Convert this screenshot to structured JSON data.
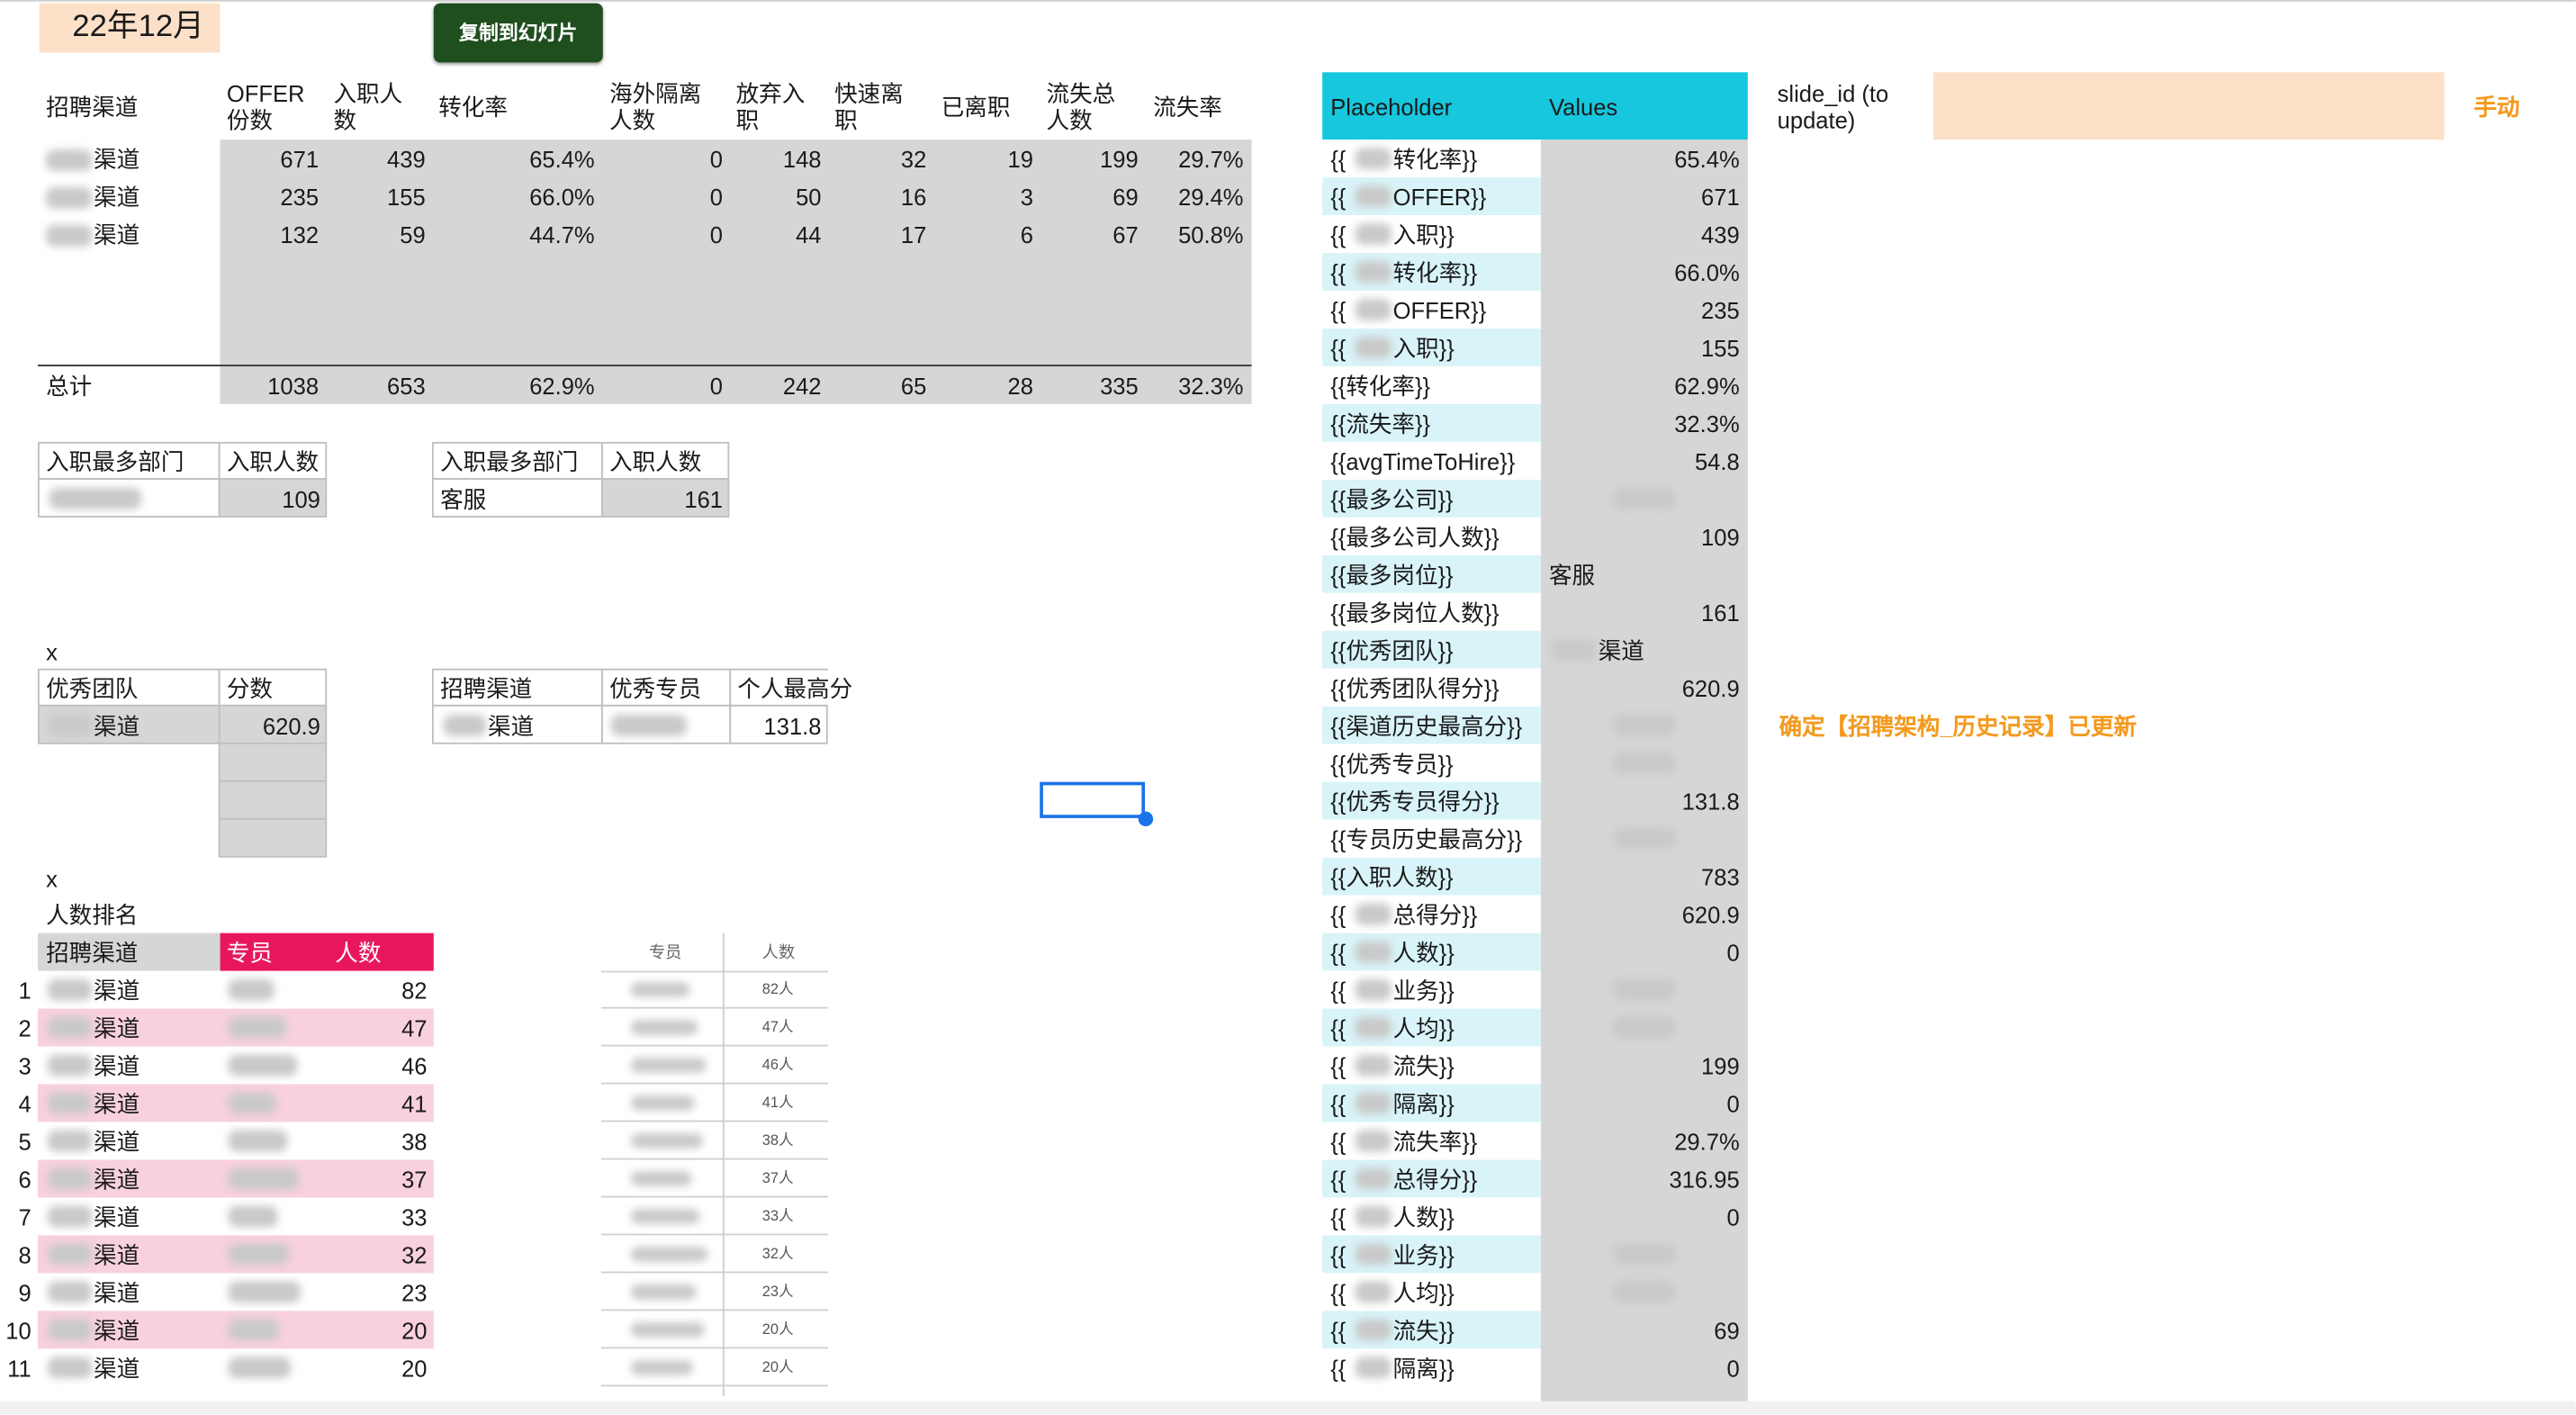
{
  "month_label": "22年12月",
  "copy_button": "复制到幻灯片",
  "channel_table": {
    "headers": [
      "招聘渠道",
      "OFFER\n份数",
      "入职人\n数",
      "转化率",
      "海外隔离\n人数",
      "放弃入\n职",
      "快速离\n职",
      "已离职",
      "流失总\n人数",
      "流失率"
    ],
    "rows": [
      {
        "channel_suffix": "渠道",
        "cells": [
          "671",
          "439",
          "65.4%",
          "0",
          "148",
          "32",
          "19",
          "199",
          "29.7%"
        ]
      },
      {
        "channel_suffix": "渠道",
        "cells": [
          "235",
          "155",
          "66.0%",
          "0",
          "50",
          "16",
          "3",
          "69",
          "29.4%"
        ]
      },
      {
        "channel_suffix": "渠道",
        "cells": [
          "132",
          "59",
          "44.7%",
          "0",
          "44",
          "17",
          "6",
          "67",
          "50.8%"
        ]
      }
    ],
    "total": {
      "label": "总计",
      "cells": [
        "1038",
        "653",
        "62.9%",
        "0",
        "242",
        "65",
        "28",
        "335",
        "32.3%"
      ]
    }
  },
  "dept_table_left": {
    "headers": [
      "入职最多部门",
      "入职人数"
    ],
    "value": "109"
  },
  "dept_table_right": {
    "headers": [
      "入职最多部门",
      "入职人数"
    ],
    "dept": "客服",
    "value": "161"
  },
  "x_marker": "x",
  "team_table": {
    "headers": [
      "优秀团队",
      "分数"
    ],
    "team_suffix": "渠道",
    "score": "620.9"
  },
  "specialist_table": {
    "headers": [
      "招聘渠道",
      "优秀专员",
      "个人最高分"
    ],
    "channel_suffix": "渠道",
    "score": "131.8"
  },
  "ranking": {
    "title": "人数排名",
    "headers": [
      "招聘渠道",
      "专员",
      "人数"
    ],
    "rows": [
      {
        "rank": "1",
        "channel_suffix": "渠道",
        "count": "82",
        "mini": "82人"
      },
      {
        "rank": "2",
        "channel_suffix": "渠道",
        "count": "47",
        "mini": "47人"
      },
      {
        "rank": "3",
        "channel_suffix": "渠道",
        "count": "46",
        "mini": "46人"
      },
      {
        "rank": "4",
        "channel_suffix": "渠道",
        "count": "41",
        "mini": "41人"
      },
      {
        "rank": "5",
        "channel_suffix": "渠道",
        "count": "38",
        "mini": "38人"
      },
      {
        "rank": "6",
        "channel_suffix": "渠道",
        "count": "37",
        "mini": "37人"
      },
      {
        "rank": "7",
        "channel_suffix": "渠道",
        "count": "33",
        "mini": "33人"
      },
      {
        "rank": "8",
        "channel_suffix": "渠道",
        "count": "32",
        "mini": "32人"
      },
      {
        "rank": "9",
        "channel_suffix": "渠道",
        "count": "23",
        "mini": "23人"
      },
      {
        "rank": "10",
        "channel_suffix": "渠道",
        "count": "20",
        "mini": "20人"
      },
      {
        "rank": "11",
        "channel_suffix": "渠道",
        "count": "20",
        "mini": "20人"
      }
    ],
    "mini_headers": [
      "专员",
      "人数"
    ]
  },
  "placeholder_table": {
    "headers": [
      "Placeholder",
      "Values"
    ],
    "rows": [
      {
        "prefix": "{{",
        "suffix": "转化率}}",
        "value": "65.4%",
        "blur_value": false
      },
      {
        "prefix": "{{",
        "suffix": "OFFER}}",
        "value": "671",
        "blur_value": false
      },
      {
        "prefix": "{{",
        "suffix": "入职}}",
        "value": "439",
        "blur_value": false
      },
      {
        "prefix": "{{",
        "suffix": "转化率}}",
        "value": "66.0%",
        "blur_value": false
      },
      {
        "prefix": "{{",
        "suffix": "OFFER}}",
        "value": "235",
        "blur_value": false
      },
      {
        "prefix": "{{",
        "suffix": "入职}}",
        "value": "155",
        "blur_value": false
      },
      {
        "prefix": "",
        "suffix": "{{转化率}}",
        "value": "62.9%",
        "blur_value": false
      },
      {
        "prefix": "",
        "suffix": "{{流失率}}",
        "value": "32.3%",
        "blur_value": false
      },
      {
        "prefix": "",
        "suffix": "{{avgTimeToHire}}",
        "value": "54.8",
        "blur_value": false
      },
      {
        "prefix": "",
        "suffix": "{{最多公司}}",
        "value": "",
        "blur_value": true
      },
      {
        "prefix": "",
        "suffix": "{{最多公司人数}}",
        "value": "109",
        "blur_value": false
      },
      {
        "prefix": "",
        "suffix": "{{最多岗位}}",
        "value": "客服",
        "blur_value": false,
        "left": true
      },
      {
        "prefix": "",
        "suffix": "{{最多岗位人数}}",
        "value": "161",
        "blur_value": false
      },
      {
        "prefix": "",
        "suffix": "{{优秀团队}}",
        "value": "渠道",
        "blur_value": true,
        "left": true
      },
      {
        "prefix": "",
        "suffix": "{{优秀团队得分}}",
        "value": "620.9",
        "blur_value": false
      },
      {
        "prefix": "",
        "suffix": "{{渠道历史最高分}}",
        "value": "",
        "blur_value": true
      },
      {
        "prefix": "",
        "suffix": "{{优秀专员}}",
        "value": "",
        "blur_value": true
      },
      {
        "prefix": "",
        "suffix": "{{优秀专员得分}}",
        "value": "131.8",
        "blur_value": false
      },
      {
        "prefix": "",
        "suffix": "{{专员历史最高分}}",
        "value": "",
        "blur_value": true
      },
      {
        "prefix": "",
        "suffix": "{{入职人数}}",
        "value": "783",
        "blur_value": false
      },
      {
        "prefix": "{{",
        "suffix": "总得分}}",
        "value": "620.9",
        "blur_value": false
      },
      {
        "prefix": "{{",
        "suffix": "人数}}",
        "value": "0",
        "blur_value": false
      },
      {
        "prefix": "{{",
        "suffix": "业务}}",
        "value": "",
        "blur_value": true
      },
      {
        "prefix": "{{",
        "suffix": "人均}}",
        "value": "",
        "blur_value": true
      },
      {
        "prefix": "{{",
        "suffix": "流失}}",
        "value": "199",
        "blur_value": false
      },
      {
        "prefix": "{{",
        "suffix": "隔离}}",
        "value": "0",
        "blur_value": false
      },
      {
        "prefix": "{{",
        "suffix": "流失率}}",
        "value": "29.7%",
        "blur_value": false
      },
      {
        "prefix": "{{",
        "suffix": "总得分}}",
        "value": "316.95",
        "blur_value": false
      },
      {
        "prefix": "{{",
        "suffix": "人数}}",
        "value": "0",
        "blur_value": false
      },
      {
        "prefix": "{{",
        "suffix": "业务}}",
        "value": "",
        "blur_value": true
      },
      {
        "prefix": "{{",
        "suffix": "人均}}",
        "value": "",
        "blur_value": true
      },
      {
        "prefix": "{{",
        "suffix": "流失}}",
        "value": "69",
        "blur_value": false
      },
      {
        "prefix": "{{",
        "suffix": "隔离}}",
        "value": "0",
        "blur_value": false
      }
    ]
  },
  "slide_id": {
    "label": "slide_id (to\nupdate)",
    "value": ""
  },
  "manual_label": "手动",
  "updated_note": "确定【招聘架构_历史记录】已更新",
  "colors": {
    "month_bg": "#fde0c8",
    "button_bg": "#1f4e1f",
    "header_pink": "#e8175d",
    "row_pink": "#f8d1dc",
    "cyan": "#16c7dd",
    "light_cyan": "#d9f4f9",
    "orange": "#f39a1f",
    "grey": "#d6d6d6"
  }
}
